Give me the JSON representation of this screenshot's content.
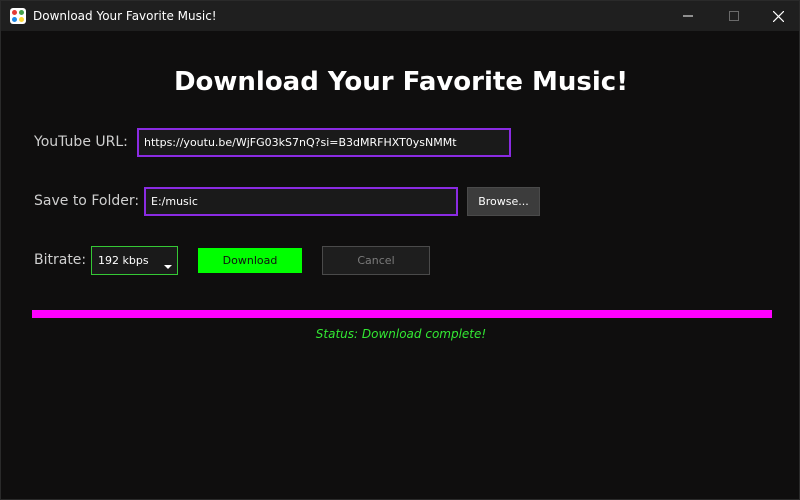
{
  "window": {
    "title": "Download Your Favorite Music!"
  },
  "main": {
    "heading": "Download Your Favorite Music!",
    "url_label": "YouTube URL:",
    "url_value": "https://youtu.be/WjFG03kS7nQ?si=B3dMRFHXT0ysNMMt",
    "folder_label": "Save to Folder:",
    "folder_value": "E:/music",
    "browse_label": "Browse...",
    "bitrate_label": "Bitrate:",
    "bitrate_selected": "192 kbps",
    "download_label": "Download",
    "cancel_label": "Cancel",
    "progress_fraction": 1.0,
    "status": "Status: Download complete!"
  },
  "colors": {
    "background": "#0f0e0e",
    "input_border": "#8a2be2",
    "download_button": "#00ff00",
    "progress_fill": "#ff00ff",
    "status_text": "#33e833",
    "bitrate_border": "#35c835"
  },
  "icons": {
    "app": "app-grid-icon",
    "minimize": "minimize-icon",
    "maximize": "maximize-icon",
    "close": "close-icon",
    "dropdown": "chevron-down-icon"
  }
}
